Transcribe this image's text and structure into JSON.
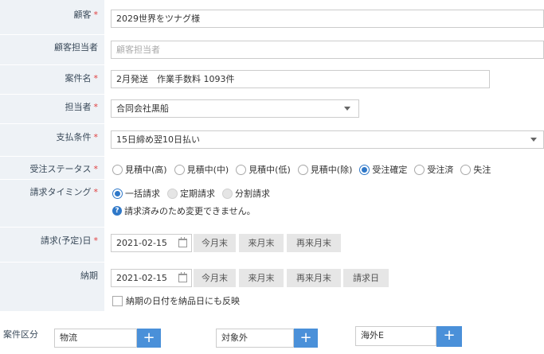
{
  "form": {
    "customer": {
      "label": "顧客",
      "value": "2029世界をツナグ様"
    },
    "customer_contact": {
      "label": "顧客担当者",
      "placeholder": "顧客担当者"
    },
    "subject": {
      "label": "案件名",
      "value": "2月発送　作業手数料 1093件"
    },
    "assignee": {
      "label": "担当者",
      "value": "合同会社黒船"
    },
    "payment_terms": {
      "label": "支払条件",
      "value": "15日締め翌10日払い"
    },
    "order_status": {
      "label": "受注ステータス",
      "options": [
        "見積中(高)",
        "見積中(中)",
        "見積中(低)",
        "見積中(除)",
        "受注確定",
        "受注済",
        "失注"
      ],
      "selected": "受注確定"
    },
    "billing_timing": {
      "label": "請求タイミング",
      "options": [
        "一括請求",
        "定期請求",
        "分割請求"
      ],
      "selected": "一括請求",
      "notice": "請求済みのため変更できません。"
    },
    "billing_date": {
      "label": "請求(予定)日",
      "value": "2021-02-15",
      "buttons": [
        "今月末",
        "来月末",
        "再来月末"
      ]
    },
    "due_date": {
      "label": "納期",
      "value": "2021-02-15",
      "buttons": [
        "今月末",
        "来月末",
        "再来月末",
        "請求日"
      ],
      "reflect_checkbox": "納期の日付を納品日にも反映"
    },
    "category": {
      "label": "案件区分",
      "values": [
        "物流",
        "対象外",
        "海外E"
      ],
      "plus": "+"
    },
    "required_mark": "*"
  },
  "colors": {
    "accent": "#2f78c8",
    "plus_button": "#4a90d9",
    "label_bg": "#eef2f6",
    "required": "#e04040"
  }
}
